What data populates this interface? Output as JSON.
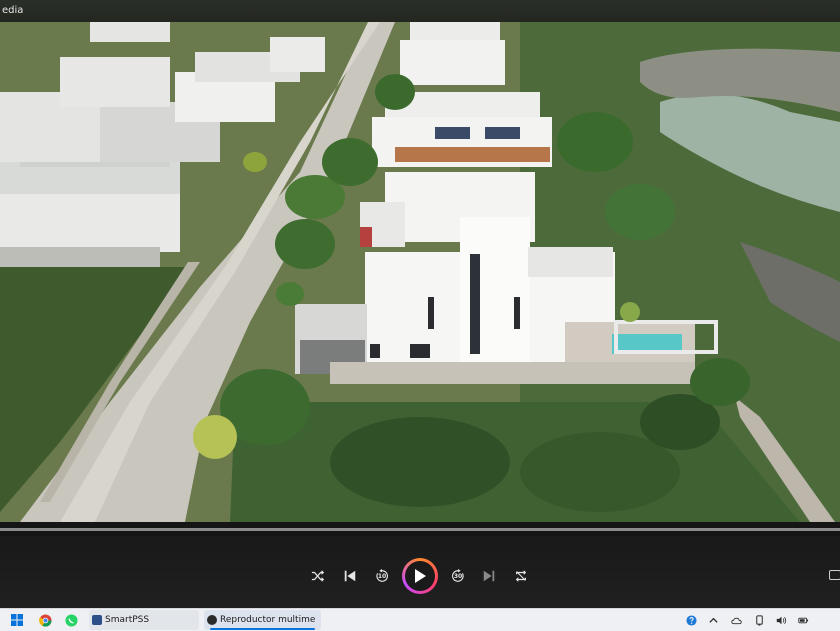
{
  "window": {
    "title": "edia"
  },
  "player": {
    "progress": 0.0
  },
  "controls": {
    "shuffle_icon": "shuffle-icon",
    "previous_icon": "skip-previous-icon",
    "rewind_label": "10",
    "play_icon": "play-icon",
    "forward_label": "30",
    "next_icon": "skip-next-icon",
    "repeat_icon": "repeat-icon"
  },
  "taskbar": {
    "apps": [
      {
        "label": "SmartPSS",
        "icon": "smartpss-icon"
      },
      {
        "label": "Reproductor multime",
        "icon": "media-player-icon"
      }
    ]
  },
  "colors": {
    "accent_orange": "#ff8a2a",
    "accent_pink": "#ff3d6e",
    "taskbar_bg": "#eef0f3"
  }
}
